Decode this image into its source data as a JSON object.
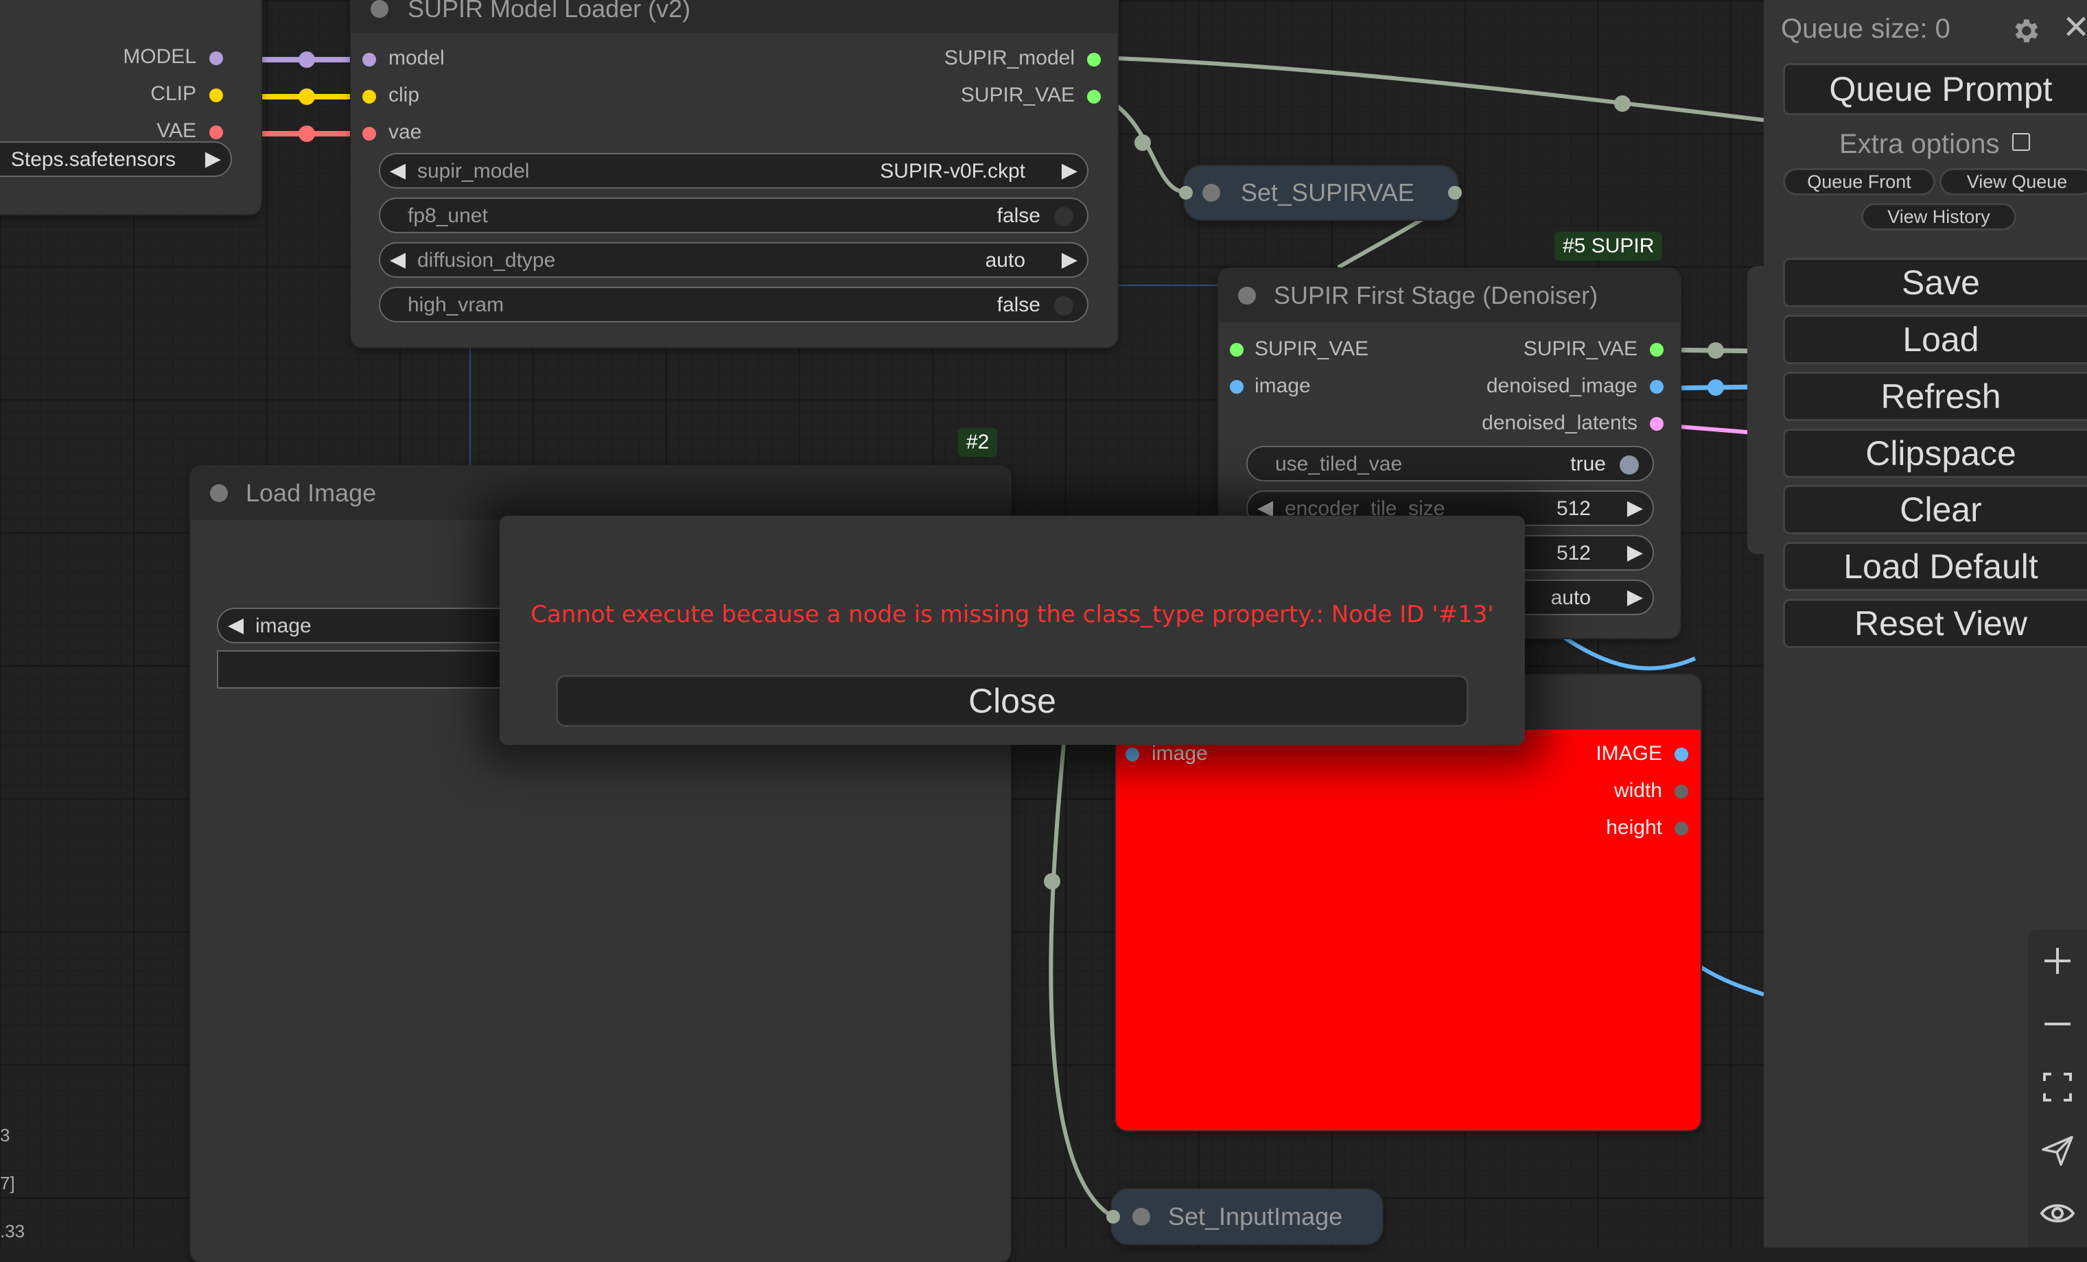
{
  "colors": {
    "accent_red": "#ff0000",
    "model": "#b39ddb",
    "clip": "#ffd500",
    "vae": "#ff6e6e",
    "image": "#64b5f6",
    "latent": "#ff9cf9",
    "green": "#7cff6a"
  },
  "left_node": {
    "outputs": [
      "MODEL",
      "CLIP",
      "VAE"
    ],
    "ckpt_value": "Steps.safetensors",
    "bottom_fragments": [
      "3",
      "7]",
      ".33"
    ]
  },
  "supir_loader": {
    "title": "SUPIR Model Loader (v2)",
    "inputs": [
      "model",
      "clip",
      "vae"
    ],
    "outputs": [
      "SUPIR_model",
      "SUPIR_VAE"
    ],
    "widgets": [
      {
        "label": "supir_model",
        "value": "SUPIR-v0F.ckpt"
      },
      {
        "label": "fp8_unet",
        "value": "false"
      },
      {
        "label": "diffusion_dtype",
        "value": "auto"
      },
      {
        "label": "high_vram",
        "value": "false"
      }
    ]
  },
  "set_supirvae": {
    "title": "Set_SUPIRVAE"
  },
  "first_stage": {
    "tag": "#5 SUPIR",
    "title": "SUPIR First Stage (Denoiser)",
    "inputs": [
      "SUPIR_VAE",
      "image"
    ],
    "outputs": [
      "SUPIR_VAE",
      "denoised_image",
      "denoised_latents"
    ],
    "widgets": [
      {
        "label": "use_tiled_vae",
        "value": "true"
      },
      {
        "label": "encoder_tile_size",
        "value": "512"
      },
      {
        "label": "",
        "value": "512"
      },
      {
        "label": "",
        "value": "auto"
      }
    ]
  },
  "load_image": {
    "tag": "#2",
    "title": "Load Image",
    "widget_label": "image"
  },
  "red_node": {
    "input": "image",
    "outputs": [
      "IMAGE",
      "width",
      "height"
    ]
  },
  "set_inputimage": {
    "title": "Set_InputImage"
  },
  "dialog": {
    "message": "Cannot execute because a node is missing the class_type property.: Node ID '#13'",
    "close_label": "Close"
  },
  "menu": {
    "queue_size": "Queue size: 0",
    "queue_prompt": "Queue Prompt",
    "extra_options": "Extra options",
    "queue_front": "Queue Front",
    "view_queue": "View Queue",
    "view_history": "View History",
    "buttons": [
      "Save",
      "Load",
      "Refresh",
      "Clipspace",
      "Clear",
      "Load Default",
      "Reset View"
    ]
  },
  "canvas_controls": [
    "zoom-in-icon",
    "zoom-out-icon",
    "fit-view-icon",
    "navigate-icon",
    "visibility-icon"
  ]
}
